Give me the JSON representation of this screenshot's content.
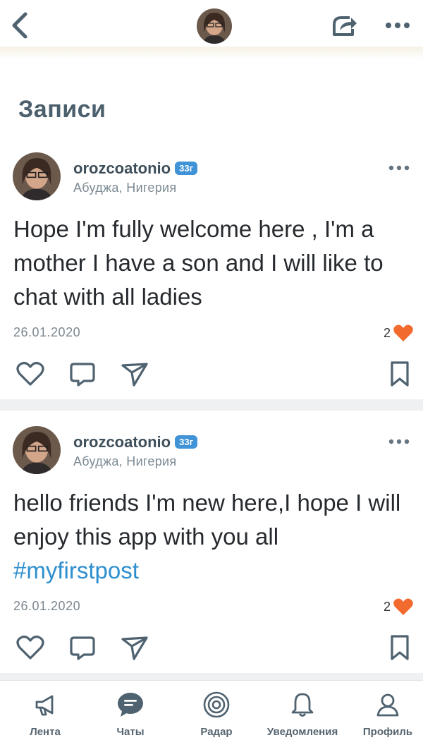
{
  "header": {
    "back_icon": "chevron-left-icon",
    "share_icon": "share-icon",
    "more_icon": "more-dots-icon"
  },
  "section_title": "Записи",
  "posts": [
    {
      "username": "orozcoatonio",
      "age_badge": "33г",
      "location": "Абуджа, Нигерия",
      "text": "Hope I'm fully welcome here , I'm a mother I have a son and I will like to chat with all ladies",
      "hashtag": "",
      "date": "26.01.2020",
      "likes": "2"
    },
    {
      "username": "orozcoatonio",
      "age_badge": "33г",
      "location": "Абуджа, Нигерия",
      "text": "hello friends I'm new here,I hope I will enjoy this app with you all",
      "hashtag": "#myfirstpost",
      "date": "26.01.2020",
      "likes": "2"
    }
  ],
  "tabs": [
    {
      "label": "Лента",
      "icon": "megaphone-icon"
    },
    {
      "label": "Чаты",
      "icon": "chat-bubble-icon"
    },
    {
      "label": "Радар",
      "icon": "radar-icon"
    },
    {
      "label": "Уведомления",
      "icon": "bell-icon"
    },
    {
      "label": "Профиль",
      "icon": "profile-icon"
    }
  ],
  "colors": {
    "accent": "#3f93d6",
    "heart": "#f26a2e",
    "title": "#4b5f6c",
    "hashtag": "#2f8fce"
  }
}
